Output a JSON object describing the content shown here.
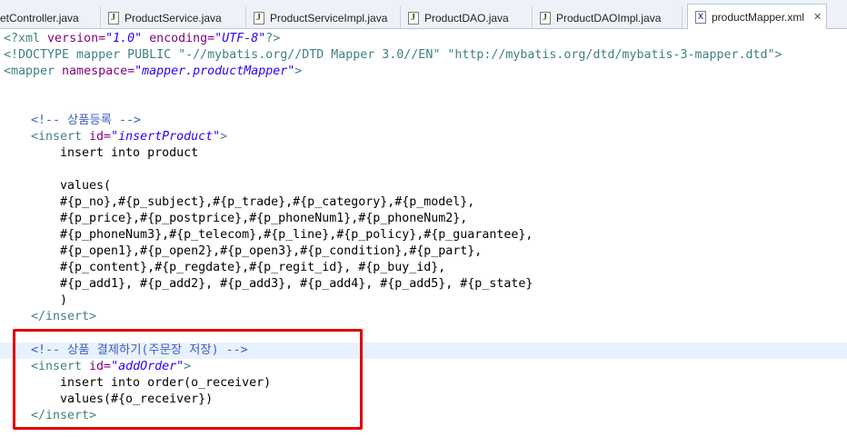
{
  "tabs": [
    {
      "label": "etController.java",
      "icon": "java-file-icon",
      "active": false
    },
    {
      "label": "ProductService.java",
      "icon": "java-file-icon",
      "active": false
    },
    {
      "label": "ProductServiceImpl.java",
      "icon": "java-file-icon",
      "active": false
    },
    {
      "label": "ProductDAO.java",
      "icon": "java-file-icon",
      "active": false
    },
    {
      "label": "ProductDAOImpl.java",
      "icon": "java-file-icon",
      "active": false
    },
    {
      "label": "productMapper.xml",
      "icon": "xml-file-icon",
      "active": true,
      "close": "✕"
    }
  ],
  "code": {
    "xml_decl": {
      "open": "<?xml ",
      "a1": "version=",
      "v1": "\"1.0\"",
      "a2": " encoding=",
      "v2": "\"UTF-8\"",
      "close": "?>"
    },
    "doctype": "<!DOCTYPE mapper PUBLIC \"-//mybatis.org//DTD Mapper 3.0//EN\" \"http://mybatis.org/dtd/mybatis-3-mapper.dtd\">",
    "mapper_open": {
      "open": "<mapper ",
      "attr": "namespace=",
      "val": "\"mapper.productMapper\"",
      "close": ">"
    },
    "comment1": "<!-- 상품등록 -->",
    "insert1_open": {
      "open": "<insert ",
      "attr": "id=",
      "val": "\"insertProduct\"",
      "close": ">"
    },
    "insert1_body": [
      "insert into product",
      "",
      "values(",
      "#{p_no},#{p_subject},#{p_trade},#{p_category},#{p_model},",
      "#{p_price},#{p_postprice},#{p_phoneNum1},#{p_phoneNum2},",
      "#{p_phoneNum3},#{p_telecom},#{p_line},#{p_policy},#{p_guarantee},",
      "#{p_open1},#{p_open2},#{p_open3},#{p_condition},#{p_part},",
      "#{p_content},#{p_regdate},#{p_regit_id}, #{p_buy_id},",
      "#{p_add1}, #{p_add2}, #{p_add3}, #{p_add4}, #{p_add5}, #{p_state}",
      ")"
    ],
    "insert_close": "</insert>",
    "comment2": "<!-- 상품 결제하기(주문장 저장) -->",
    "insert2_open": {
      "open": "<insert ",
      "attr": "id=",
      "val": "\"addOrder\"",
      "close": ">"
    },
    "insert2_body": [
      "insert into order(o_receiver)",
      "values(#{o_receiver})"
    ]
  },
  "annotation_color": "#e00000"
}
